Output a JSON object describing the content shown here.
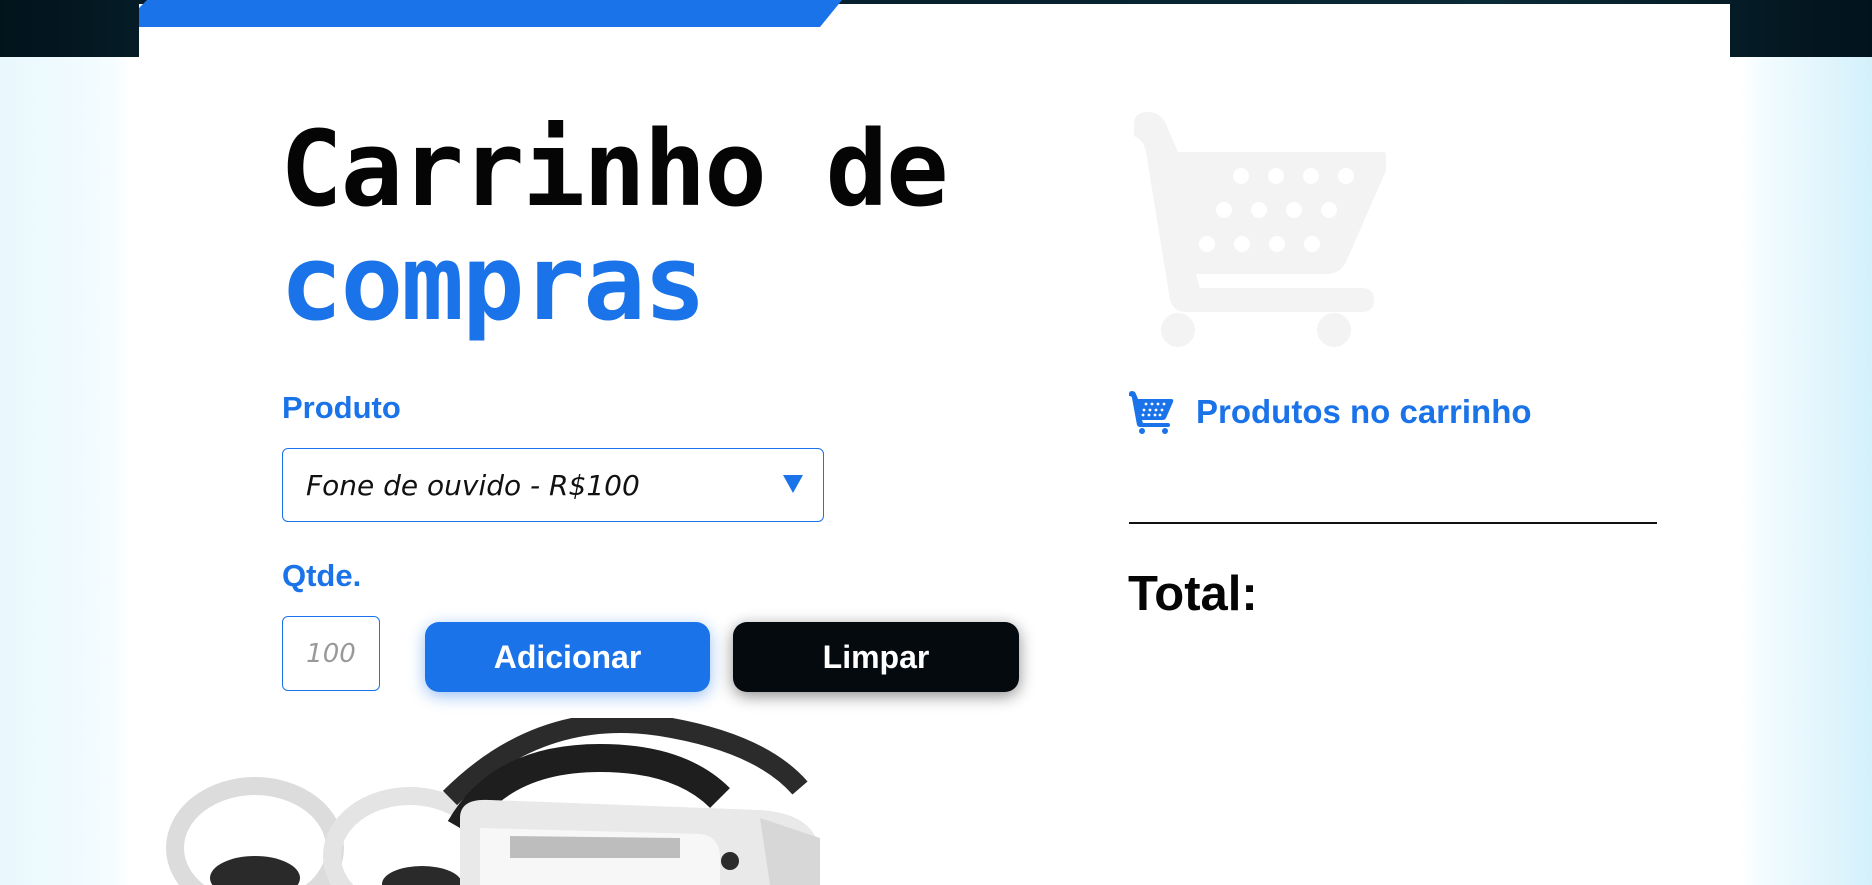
{
  "page": {
    "title_line1": "Carrinho de",
    "title_line2": "compras"
  },
  "form": {
    "product_label": "Produto",
    "product_selected": "Fone de ouvido - R$100",
    "quantity_label": "Qtde.",
    "quantity_placeholder": "100",
    "add_button": "Adicionar",
    "clear_button": "Limpar"
  },
  "cart": {
    "header": "Produtos no carrinho",
    "total_label": "Total:"
  },
  "icons": {
    "large_cart": "shopping-cart-icon",
    "small_cart": "shopping-cart-icon",
    "select_arrow": "triangle-down-icon",
    "product_image": "vr-headset-image"
  },
  "colors": {
    "accent": "#1a73e8",
    "dark": "#050a0e",
    "faint_cart": "#f3f3f3"
  }
}
